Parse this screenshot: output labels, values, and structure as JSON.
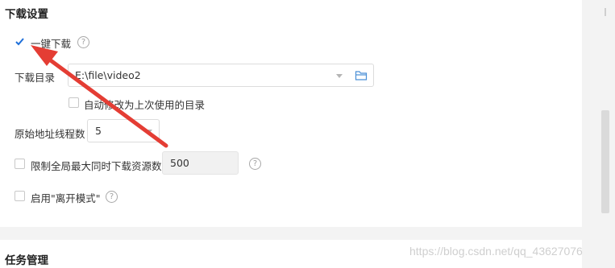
{
  "download_settings": {
    "title": "下载设置",
    "one_click": {
      "label": "一键下载",
      "checked": true,
      "help": "?"
    },
    "download_dir": {
      "label": "下载目录",
      "value": "E:\\file\\video2"
    },
    "auto_modify": {
      "label": "自动修改为上次使用的目录",
      "checked": false
    },
    "threads": {
      "label": "原始地址线程数",
      "value": "5"
    },
    "limit_concurrent": {
      "label": "限制全局最大同时下载资源数",
      "checked": false,
      "value": "500",
      "help": "?"
    },
    "offline_mode": {
      "label": "启用\"离开模式\"",
      "checked": false,
      "help": "?"
    }
  },
  "task_management": {
    "title": "任务管理"
  },
  "watermark": "https://blog.csdn.net/qq_43627076",
  "colors": {
    "accent": "#1e6fd9",
    "arrow": "#e43d34"
  },
  "icons": [
    "checkmark-icon",
    "help-icon",
    "chevron-down-icon",
    "folder-icon"
  ]
}
